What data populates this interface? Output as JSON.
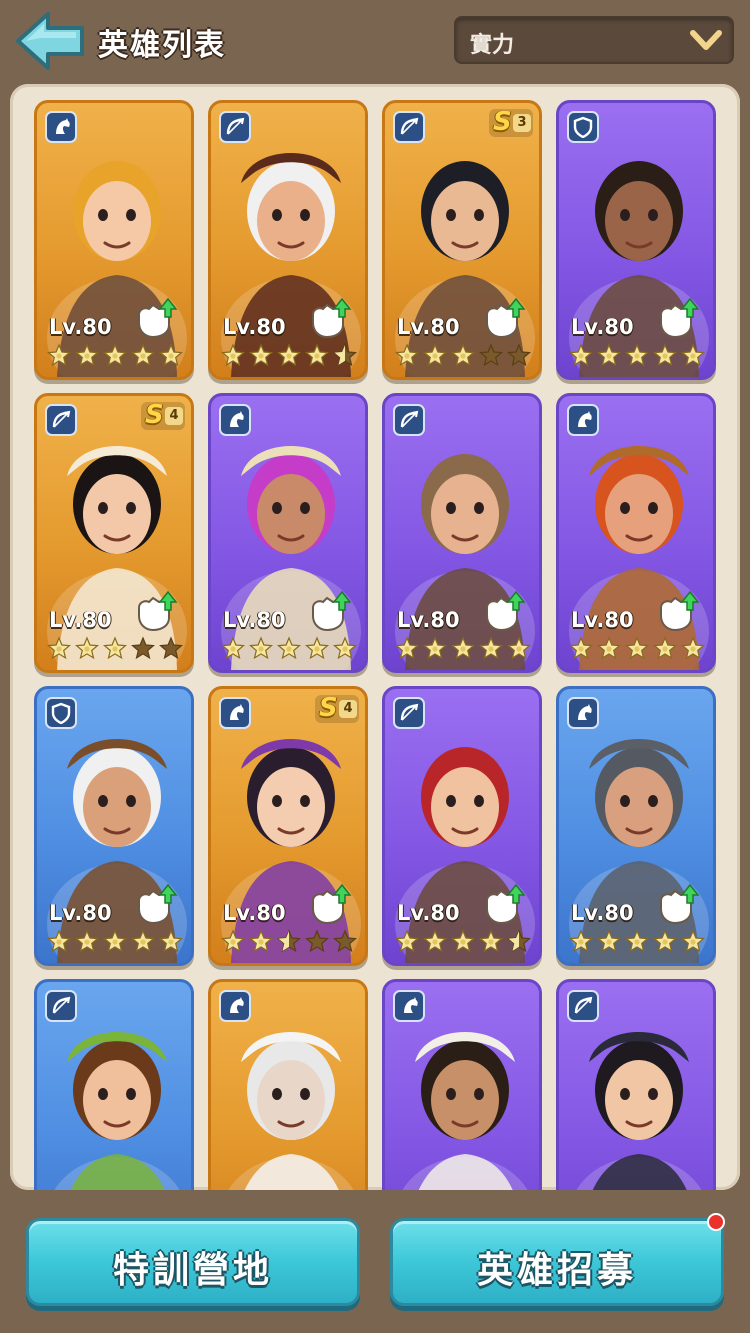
{
  "header": {
    "title": "英雄列表",
    "back_icon": "back-arrow-icon",
    "sort": {
      "selected": "實力",
      "icon": "chevron-down-icon"
    }
  },
  "heroes": [
    {
      "bg": "orange",
      "role": "cavalry",
      "level": "Lv.80",
      "stars": 5,
      "half": false,
      "season": "",
      "skin": "#f5c9a6",
      "hair": "#e8a32a",
      "hat": ""
    },
    {
      "bg": "orange",
      "role": "archer",
      "level": "Lv.80",
      "stars": 4,
      "half": true,
      "season": "",
      "skin": "#e9b08a",
      "hair": "#f0f0f0",
      "hat": "#5a2a1c"
    },
    {
      "bg": "orange",
      "role": "archer",
      "level": "Lv.80",
      "stars": 3,
      "half": false,
      "season": "S3",
      "skin": "#e9b994",
      "hair": "#1e1e26",
      "hat": ""
    },
    {
      "bg": "purple",
      "role": "infantry",
      "level": "Lv.80",
      "stars": 5,
      "half": false,
      "season": "",
      "skin": "#9a6448",
      "hair": "#2a1e16",
      "hat": ""
    },
    {
      "bg": "orange",
      "role": "archer",
      "level": "Lv.80",
      "stars": 3,
      "half": false,
      "season": "S4",
      "skin": "#f2c8a8",
      "hair": "#1b1414",
      "hat": "#f4ead6"
    },
    {
      "bg": "purple",
      "role": "cavalry",
      "level": "Lv.80",
      "stars": 5,
      "half": false,
      "season": "",
      "skin": "#c98a6a",
      "hair": "#c53cc8",
      "hat": "#ece0b8"
    },
    {
      "bg": "purple",
      "role": "archer",
      "level": "Lv.80",
      "stars": 5,
      "half": false,
      "season": "",
      "skin": "#e6b290",
      "hair": "#8a6a4a",
      "hat": ""
    },
    {
      "bg": "purple",
      "role": "cavalry",
      "level": "Lv.80",
      "stars": 5,
      "half": false,
      "season": "",
      "skin": "#e6a07c",
      "hair": "#d8541e",
      "hat": "#b06a2a"
    },
    {
      "bg": "blue",
      "role": "infantry",
      "level": "Lv.80",
      "stars": 5,
      "half": false,
      "season": "",
      "skin": "#d9a07a",
      "hair": "#f0f0f0",
      "hat": "#7a4e2a"
    },
    {
      "bg": "orange",
      "role": "cavalry",
      "level": "Lv.80",
      "stars": 2,
      "half": true,
      "season": "S4",
      "skin": "#f4cdb0",
      "hair": "#2a1e2e",
      "hat": "#7e3aa8"
    },
    {
      "bg": "purple",
      "role": "archer",
      "level": "Lv.80",
      "stars": 4,
      "half": true,
      "season": "",
      "skin": "#f0c2a0",
      "hair": "#b8262a",
      "hat": ""
    },
    {
      "bg": "blue",
      "role": "cavalry",
      "level": "Lv.80",
      "stars": 5,
      "half": false,
      "season": "",
      "skin": "#d8a07e",
      "hair": "#555a62",
      "hat": "#5a5f68"
    },
    {
      "bg": "blue",
      "role": "archer",
      "level": "",
      "stars": 0,
      "half": false,
      "season": "",
      "skin": "#f0c09c",
      "hair": "#6a3a1a",
      "hat": "#7ab43a"
    },
    {
      "bg": "orange",
      "role": "cavalry",
      "level": "",
      "stars": 0,
      "half": false,
      "season": "",
      "skin": "#e8d6c8",
      "hair": "#e8e8e8",
      "hat": "#f4f4f4"
    },
    {
      "bg": "purple",
      "role": "cavalry",
      "level": "",
      "stars": 0,
      "half": false,
      "season": "",
      "skin": "#c89068",
      "hair": "#2a1e16",
      "hat": "#f2efe6"
    },
    {
      "bg": "purple",
      "role": "archer",
      "level": "",
      "stars": 0,
      "half": false,
      "season": "",
      "skin": "#f0c6a4",
      "hair": "#1e1a20",
      "hat": "#2a2a3a"
    }
  ],
  "bottom": {
    "left_label": "特訓營地",
    "right_label": "英雄招募",
    "right_has_notification": true
  },
  "colors": {
    "orange": "#e49a2e",
    "purple": "#8458e4",
    "blue": "#4f8ee2",
    "star_on": "#f4e7a4",
    "star_off": "#7a5a2a",
    "button": "#3cc7d8"
  }
}
